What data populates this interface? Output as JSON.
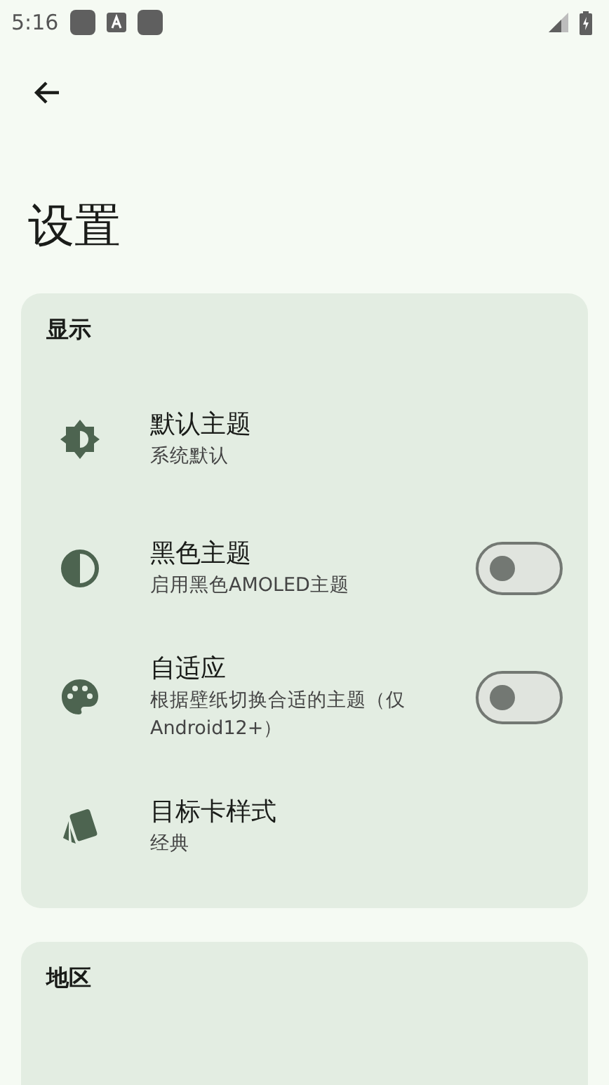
{
  "status_bar": {
    "time": "5:16"
  },
  "page": {
    "title": "设置"
  },
  "sections": [
    {
      "title": "显示",
      "items": [
        {
          "kind": "nav",
          "title": "默认主题",
          "subtitle": "系统默认"
        },
        {
          "kind": "switch",
          "title": "黑色主题",
          "subtitle": "启用黑色AMOLED主题",
          "on": false
        },
        {
          "kind": "switch",
          "title": "自适应",
          "subtitle": "根据壁纸切换合适的主题（仅Android12+）",
          "on": false
        },
        {
          "kind": "nav",
          "title": "目标卡样式",
          "subtitle": "经典"
        }
      ]
    },
    {
      "title": "地区"
    }
  ]
}
